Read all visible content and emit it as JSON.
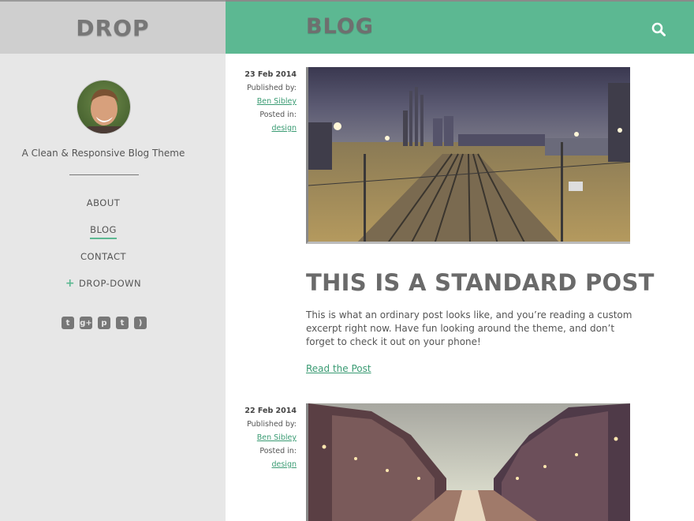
{
  "site": {
    "logo": "DROP",
    "tagline": "A Clean & Responsive Blog Theme",
    "accent_color": "#5cb892"
  },
  "nav": {
    "items": [
      {
        "label": "ABOUT"
      },
      {
        "label": "BLOG"
      },
      {
        "label": "CONTACT"
      },
      {
        "label": "DROP-DOWN",
        "prefix": "+"
      }
    ]
  },
  "social": [
    {
      "icon": "twitter-icon",
      "glyph": "t"
    },
    {
      "icon": "google-plus-icon",
      "glyph": "g+"
    },
    {
      "icon": "pinterest-icon",
      "glyph": "p"
    },
    {
      "icon": "tumblr-icon",
      "glyph": "t"
    },
    {
      "icon": "rss-icon",
      "glyph": ")"
    }
  ],
  "header": {
    "title": "BLOG",
    "search_icon": "search-icon"
  },
  "posts": [
    {
      "date": "23 Feb 2014",
      "published_label": "Published by:",
      "author": "Ben Sibley",
      "posted_label": "Posted in:",
      "category": "design",
      "image": "railway-tracks-at-dusk",
      "title": "THIS IS A STANDARD POST",
      "excerpt": "This is what an ordinary post looks like, and you’re reading a custom excerpt right now. Have fun looking around the theme, and don’t forget to check it out on your phone!",
      "read_more": "Read the Post"
    },
    {
      "date": "22 Feb 2014",
      "published_label": "Published by:",
      "author": "Ben Sibley",
      "posted_label": "Posted in:",
      "category": "design",
      "image": "canal-with-buildings-at-dusk"
    }
  ]
}
